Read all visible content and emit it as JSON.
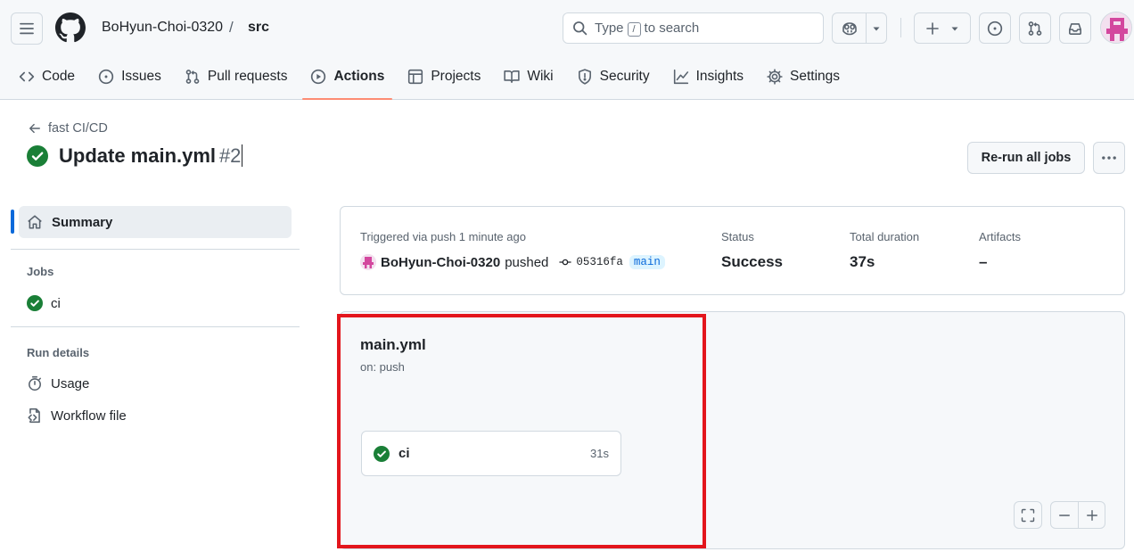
{
  "header": {
    "owner": "BoHyun-Choi-0320",
    "separator": "/",
    "repo": "src",
    "search": {
      "prefix": "Type",
      "key": "/",
      "suffix": "to search"
    }
  },
  "nav": {
    "tabs": [
      {
        "label": "Code",
        "icon": "code-icon"
      },
      {
        "label": "Issues",
        "icon": "issue-opened-icon"
      },
      {
        "label": "Pull requests",
        "icon": "git-pull-request-icon"
      },
      {
        "label": "Actions",
        "icon": "play-icon",
        "selected": true
      },
      {
        "label": "Projects",
        "icon": "table-icon"
      },
      {
        "label": "Wiki",
        "icon": "book-icon"
      },
      {
        "label": "Security",
        "icon": "shield-icon"
      },
      {
        "label": "Insights",
        "icon": "graph-icon"
      },
      {
        "label": "Settings",
        "icon": "gear-icon"
      }
    ]
  },
  "run": {
    "back_label": "fast CI/CD",
    "title": "Update main.yml",
    "number": "#2",
    "rerun_label": "Re-run all jobs"
  },
  "sidebar": {
    "summary": "Summary",
    "jobs_heading": "Jobs",
    "jobs": [
      {
        "label": "ci"
      }
    ],
    "run_details_heading": "Run details",
    "details": [
      {
        "label": "Usage",
        "icon": "stopwatch-icon"
      },
      {
        "label": "Workflow file",
        "icon": "file-code-icon"
      }
    ]
  },
  "summary": {
    "trigger_label": "Triggered via push 1 minute ago",
    "actor": "BoHyun-Choi-0320",
    "action": "pushed",
    "commit": "05316fa",
    "branch": "main",
    "status_label": "Status",
    "status_value": "Success",
    "duration_label": "Total duration",
    "duration_value": "37s",
    "artifacts_label": "Artifacts",
    "artifacts_value": "–"
  },
  "graph": {
    "workflow_name": "main.yml",
    "trigger": "on: push",
    "jobs": [
      {
        "name": "ci",
        "duration": "31s"
      }
    ]
  },
  "colors": {
    "success": "#1a7f37",
    "accent": "#0969da",
    "tab_underline": "#fd8c73",
    "highlight": "#e3161c"
  }
}
